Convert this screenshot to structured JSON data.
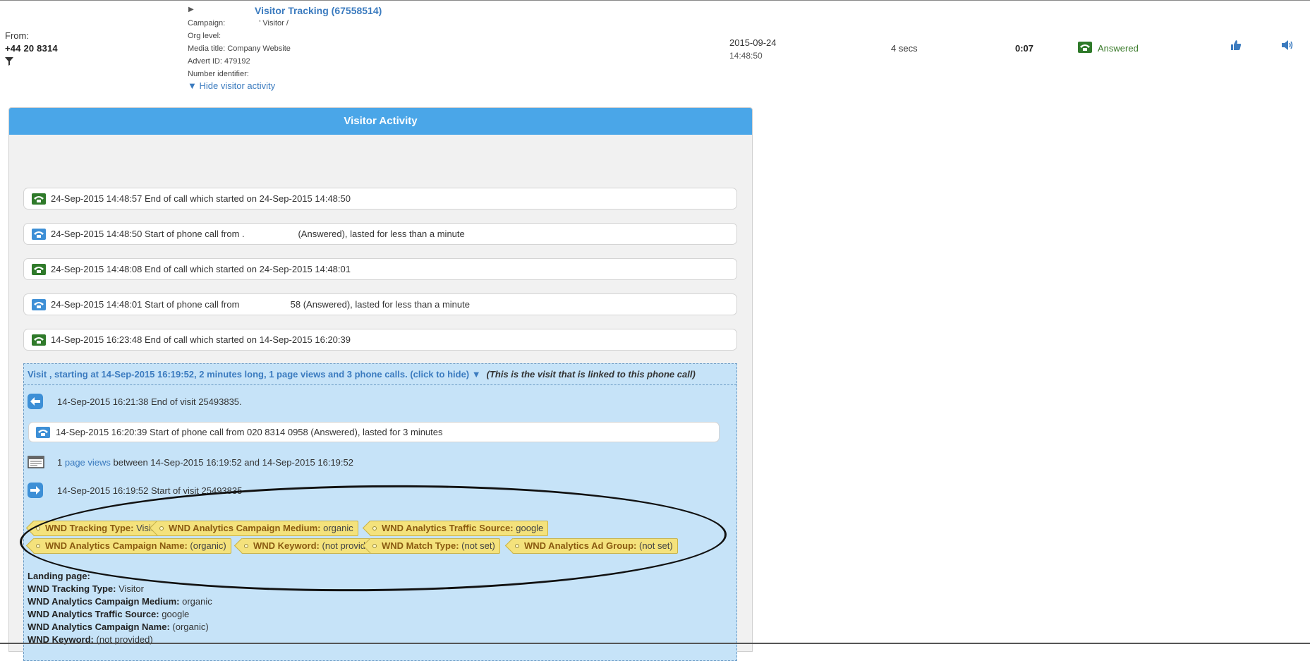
{
  "call": {
    "from_label": "From:",
    "from_number": "+44 20 8314",
    "title": "Visitor Tracking (67558514)",
    "meta": [
      "Campaign:",
      "Org level:",
      "Media title: Company Website",
      "Advert ID: 479192",
      "Number identifier:"
    ],
    "campaign_value": "' Visitor /",
    "hide_link": "▼ Hide visitor activity",
    "date": "2015-09-24",
    "time": "14:48:50",
    "duration": "4 secs",
    "talk_time": "0:07",
    "status": "Answered",
    "status_color": "#3a7a2a"
  },
  "panel": {
    "title": "Visitor Activity",
    "header_color": "#4aa6e8",
    "events": [
      {
        "text": "24-Sep-2015 14:48:57 End of call which started on 24-Sep-2015 14:48:50",
        "icon": "phone-end-icon"
      },
      {
        "text": "24-Sep-2015 14:48:50 Start of phone call from .                     (Answered), lasted for less than a minute",
        "icon": "phone-start-icon"
      },
      {
        "text": "24-Sep-2015 14:48:08 End of call which started on 24-Sep-2015 14:48:01",
        "icon": "phone-end-icon"
      },
      {
        "text": "24-Sep-2015 14:48:01 Start of phone call from                    58 (Answered), lasted for less than a minute",
        "icon": "phone-start-icon"
      },
      {
        "text": "14-Sep-2015 16:23:48 End of call which started on 14-Sep-2015 16:20:39",
        "icon": "phone-end-icon"
      }
    ],
    "visit": {
      "header_link": "Visit , starting at 14-Sep-2015 16:19:52, 2 minutes long, 1 page views and 3 phone calls. (click to hide) ▼",
      "header_note": "(This is the visit that is linked to this phone call)",
      "end_visit": "14-Sep-2015 16:21:38 End of visit 25493835.",
      "inner_call": "14-Sep-2015 16:20:39 Start of phone call from 020 8314 0958 (Answered), lasted for 3 minutes",
      "pageviews_count": "1",
      "pageviews_link": "page views",
      "pageviews_rest": "between 14-Sep-2015 16:19:52 and 14-Sep-2015 16:19:52",
      "start_visit": "14-Sep-2015 16:19:52 Start of visit 25493835",
      "tags": [
        {
          "key": "WND Tracking Type:",
          "value": "Visitor"
        },
        {
          "key": "WND Analytics Campaign Medium:",
          "value": "organic"
        },
        {
          "key": "WND Analytics Traffic Source:",
          "value": "google"
        },
        {
          "key": "WND Analytics Campaign Name:",
          "value": "(organic)"
        },
        {
          "key": "WND Keyword:",
          "value": "(not provided)"
        },
        {
          "key": "WND Match Type:",
          "value": "(not set)"
        },
        {
          "key": "WND Analytics Ad Group:",
          "value": "(not set)"
        }
      ],
      "details": [
        {
          "key": "Landing page:",
          "value": ""
        },
        {
          "key": "WND Tracking Type:",
          "value": "Visitor"
        },
        {
          "key": "WND Analytics Campaign Medium:",
          "value": "organic"
        },
        {
          "key": "WND Analytics Traffic Source:",
          "value": "google"
        },
        {
          "key": "WND Analytics Campaign Name:",
          "value": "(organic)"
        },
        {
          "key": "WND Keyword:",
          "value": "(not provided)"
        }
      ]
    }
  }
}
